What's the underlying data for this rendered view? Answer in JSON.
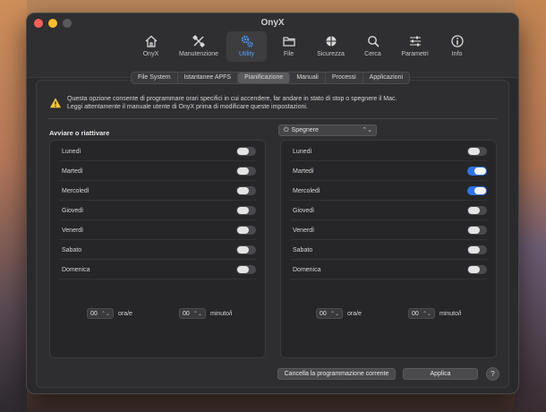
{
  "window": {
    "title": "OnyX"
  },
  "toolbar": {
    "items": [
      {
        "label": "OnyX",
        "icon": "home-icon",
        "active": false
      },
      {
        "label": "Manutenzione",
        "icon": "tools-icon",
        "active": false
      },
      {
        "label": "Utility",
        "icon": "gears-icon",
        "active": true
      },
      {
        "label": "File",
        "icon": "folder-icon",
        "active": false
      },
      {
        "label": "Sicurezza",
        "icon": "shield-icon",
        "active": false
      },
      {
        "label": "Cerca",
        "icon": "search-icon",
        "active": false
      },
      {
        "label": "Parametri",
        "icon": "sliders-icon",
        "active": false
      },
      {
        "label": "Info",
        "icon": "info-icon",
        "active": false
      }
    ]
  },
  "tabs": [
    "File System",
    "Istantanee APFS",
    "Pianificazione",
    "Manuali",
    "Processi",
    "Applicazioni"
  ],
  "active_tab": "Pianificazione",
  "warning": {
    "line1": "Questa opzione consente di programmare orari specifici in cui accendere, far andare in stato di stop o spegnere il Mac.",
    "line2": "Leggi attentamente il manuale utente di OnyX prima di modificare queste impostazioni."
  },
  "left_panel": {
    "title": "Avviare o riattivare",
    "days": [
      {
        "label": "Lunedì",
        "on": false
      },
      {
        "label": "Martedì",
        "on": false
      },
      {
        "label": "Mercoledì",
        "on": false
      },
      {
        "label": "Giovedì",
        "on": false
      },
      {
        "label": "Venerdì",
        "on": false
      },
      {
        "label": "Sabato",
        "on": false
      },
      {
        "label": "Domenica",
        "on": false
      }
    ],
    "hour_value": "00",
    "hour_unit": "ora/e",
    "minute_value": "00",
    "minute_unit": "minuto/i"
  },
  "right_panel": {
    "dropdown": "Spegnere",
    "days": [
      {
        "label": "Lunedì",
        "on": false
      },
      {
        "label": "Martedì",
        "on": true
      },
      {
        "label": "Mercoledì",
        "on": true
      },
      {
        "label": "Giovedì",
        "on": false
      },
      {
        "label": "Venerdì",
        "on": false
      },
      {
        "label": "Sabato",
        "on": false
      },
      {
        "label": "Domenica",
        "on": false
      }
    ],
    "hour_value": "00",
    "hour_unit": "ora/e",
    "minute_value": "00",
    "minute_unit": "minuto/i"
  },
  "buttons": {
    "cancel": "Cancella la programmazione corrente",
    "apply": "Applica",
    "help": "?"
  },
  "colors": {
    "accent": "#2f74e6",
    "warning": "#f5c53a"
  }
}
